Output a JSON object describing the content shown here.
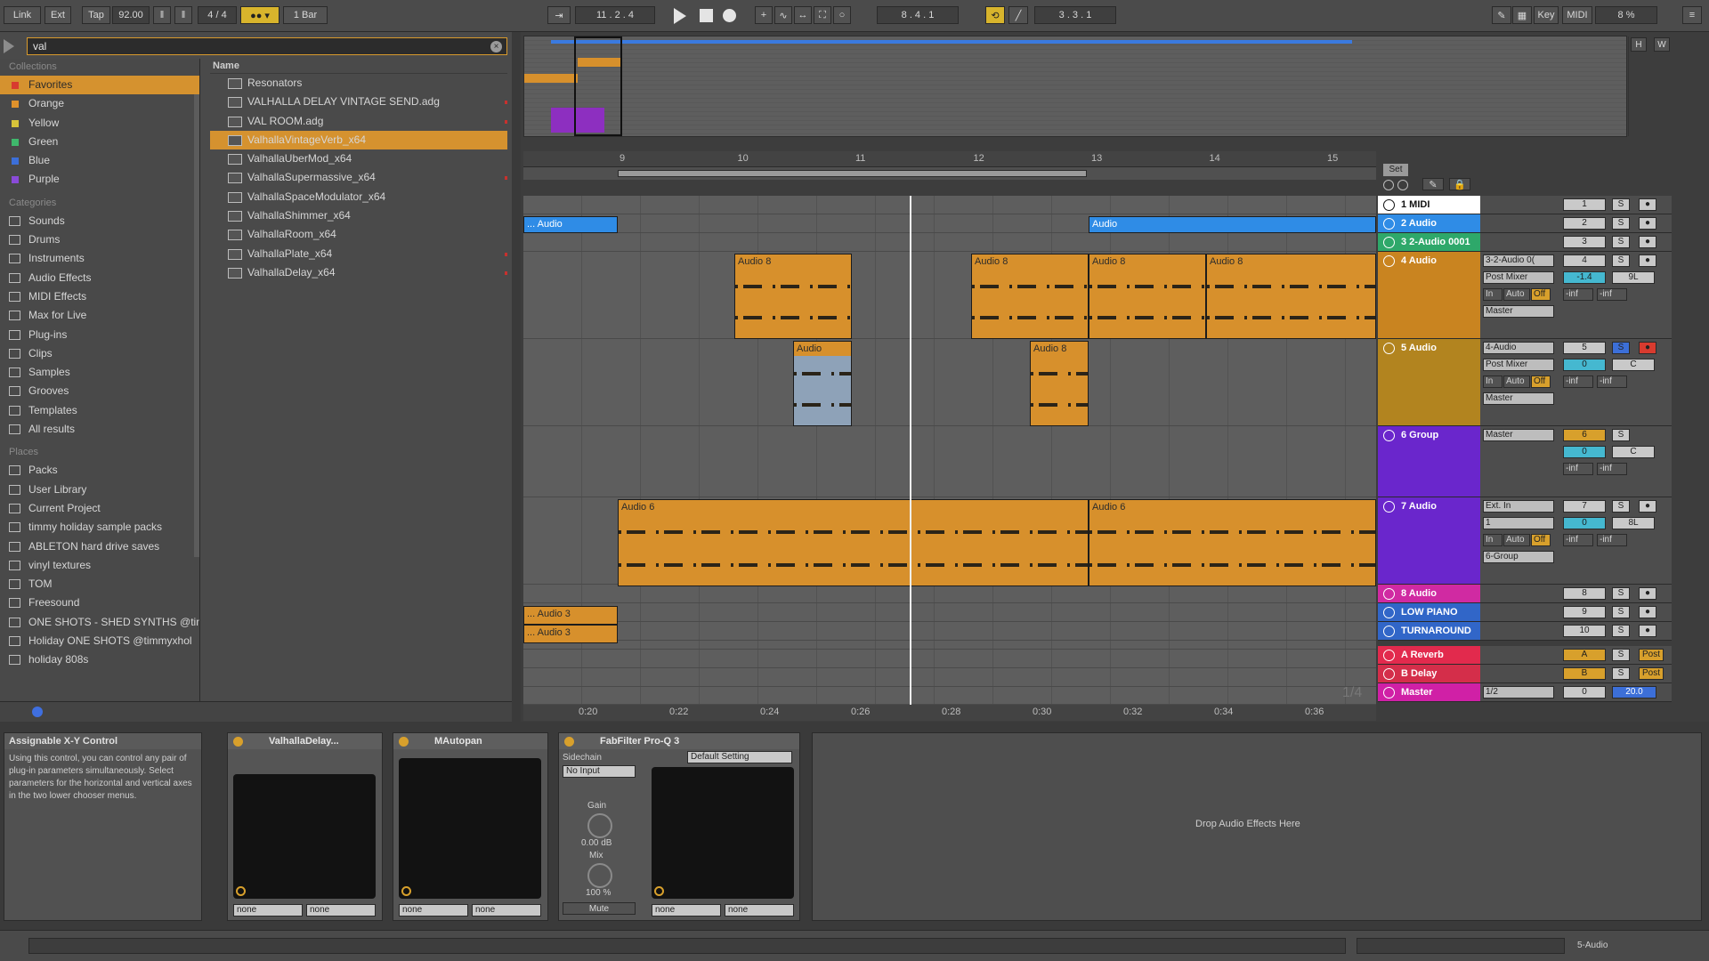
{
  "transport": {
    "link": "Link",
    "ext": "Ext",
    "tap": "Tap",
    "tempo": "92.00",
    "signature": "4 / 4",
    "quantize": "1 Bar",
    "position": "11 .  2 .  4",
    "loop_start": "8 .  4 .  1",
    "loop_length": "3 .  3 .  1",
    "key": "Key",
    "midi": "MIDI",
    "cpu": "8 %"
  },
  "browser": {
    "search_value": "val",
    "collections_label": "Collections",
    "collections": [
      {
        "label": "Favorites",
        "color": "#d83b2f"
      },
      {
        "label": "Orange",
        "color": "#e0922c"
      },
      {
        "label": "Yellow",
        "color": "#d7c43a"
      },
      {
        "label": "Green",
        "color": "#3fb86c"
      },
      {
        "label": "Blue",
        "color": "#3c6fd8"
      },
      {
        "label": "Purple",
        "color": "#8a4bd8"
      }
    ],
    "categories_label": "Categories",
    "categories": [
      "Sounds",
      "Drums",
      "Instruments",
      "Audio Effects",
      "MIDI Effects",
      "Max for Live",
      "Plug-ins",
      "Clips",
      "Samples",
      "Grooves",
      "Templates",
      "All results"
    ],
    "places_label": "Places",
    "places": [
      "Packs",
      "User Library",
      "Current Project",
      "timmy holiday sample packs",
      "ABLETON hard drive saves",
      "vinyl textures",
      "TOM",
      "Freesound",
      "ONE SHOTS - SHED SYNTHS @tim",
      "Holiday ONE SHOTS @timmyxhol",
      "holiday 808s"
    ],
    "name_header": "Name",
    "files": [
      "Resonators",
      "VALHALLA DELAY VINTAGE SEND.adg",
      "VAL ROOM.adg",
      "ValhallaVintageVerb_x64",
      "ValhallaUberMod_x64",
      "ValhallaSupermassive_x64",
      "ValhallaSpaceModulator_x64",
      "ValhallaShimmer_x64",
      "ValhallaRoom_x64",
      "ValhallaPlate_x64",
      "ValhallaDelay_x64"
    ]
  },
  "ruler": {
    "bars": [
      "9",
      "10",
      "11",
      "12",
      "13",
      "14",
      "15"
    ],
    "times": [
      "0:20",
      "0:22",
      "0:24",
      "0:26",
      "0:28",
      "0:30",
      "0:32",
      "0:34",
      "0:36"
    ],
    "set": "Set",
    "page": "1/4"
  },
  "clips": {
    "audio_a": "... Audio",
    "audio_b": "Audio",
    "audio8": "Audio 8",
    "audio_blue": "Audio",
    "audio6": "Audio 6",
    "audio3a": "... Audio 3",
    "audio3b": "... Audio 3"
  },
  "tracks": [
    {
      "name": "1 MIDI",
      "color": "#ffffff",
      "text": "#111111",
      "num": "1"
    },
    {
      "name": "2 Audio",
      "color": "#2f8ce6",
      "text": "#ffffff",
      "num": "2"
    },
    {
      "name": "3 2-Audio 0001",
      "color": "#2ea86a",
      "text": "#ffffff",
      "num": "3"
    },
    {
      "name": "4 Audio",
      "color": "#c98420",
      "text": "#ffffff",
      "num": "4",
      "input": "3-2-Audio 0(",
      "monitor": "Post Mixer",
      "out": "Master",
      "vol": "-1.4",
      "pan": "9L"
    },
    {
      "name": "5 Audio",
      "color": "#b2841f",
      "text": "#ffffff",
      "num": "5",
      "input": "4-Audio",
      "monitor": "Post Mixer",
      "out": "Master",
      "vol": "0",
      "pan": "C"
    },
    {
      "name": "6 Group",
      "color": "#6a26cc",
      "text": "#ffffff",
      "num": "6",
      "out": "Master",
      "vol": "0",
      "pan": "C"
    },
    {
      "name": "7 Audio",
      "color": "#6a26cc",
      "text": "#ffffff",
      "num": "7",
      "input": "Ext. In",
      "monitor": "1",
      "out": "6-Group",
      "vol": "0",
      "pan": "8L"
    },
    {
      "name": "8 Audio",
      "color": "#d02aa2",
      "text": "#ffffff",
      "num": "8"
    },
    {
      "name": "LOW PIANO",
      "color": "#3166c8",
      "text": "#ffffff",
      "num": "9"
    },
    {
      "name": "TURNAROUND",
      "color": "#3166c8",
      "text": "#ffffff",
      "num": "10"
    },
    {
      "name": "A Reverb",
      "color": "#e22a4d",
      "text": "#ffffff",
      "num": "A"
    },
    {
      "name": "B Delay",
      "color": "#d42e4a",
      "text": "#ffffff",
      "num": "B"
    },
    {
      "name": "Master",
      "color": "#d020a6",
      "text": "#ffffff",
      "num": "0"
    }
  ],
  "mixer": {
    "in": "In",
    "auto": "Auto",
    "off": "Off",
    "inf": "-inf",
    "s": "S",
    "post": "Post",
    "master_cue": "1/2",
    "master_vol": "20.0"
  },
  "devices": {
    "info_title": "Assignable X-Y Control",
    "info_text": "Using this control, you can control any pair of plug-in parameters simultaneously. Select parameters for the horizontal and vertical axes in the two lower chooser menus.",
    "d1": "ValhallaDelay...",
    "d2": "MAutopan",
    "d3": "FabFilter Pro-Q 3",
    "none": "none",
    "sidechain": "Sidechain",
    "no_input": "No Input",
    "gain": "Gain",
    "gain_val": "0.00 dB",
    "mix": "Mix",
    "mix_val": "100 %",
    "mute": "Mute",
    "preset": "Default Setting",
    "drop": "Drop Audio Effects Here"
  },
  "status": {
    "track": "5-Audio"
  }
}
